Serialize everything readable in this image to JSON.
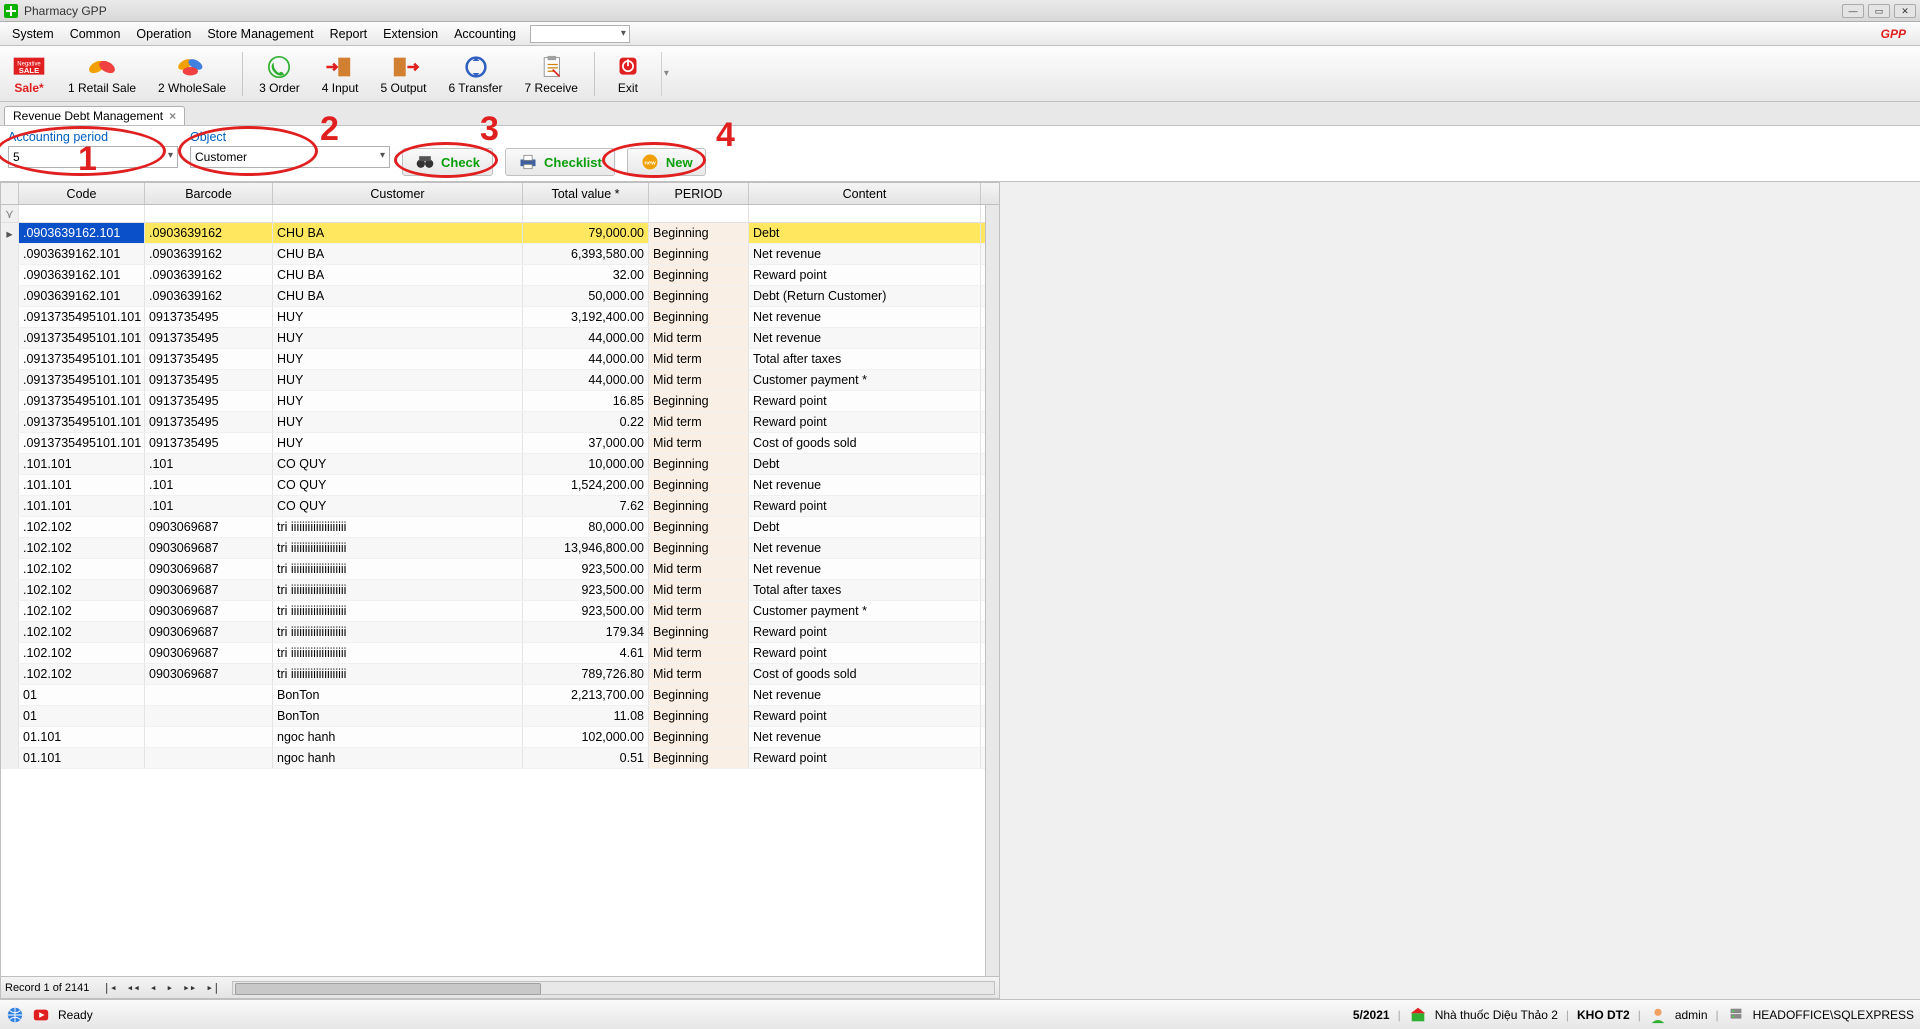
{
  "window": {
    "title": "Pharmacy GPP",
    "gpp": "GPP"
  },
  "menu": [
    "System",
    "Common",
    "Operation",
    "Store Management",
    "Report",
    "Extension",
    "Accounting"
  ],
  "toolbar": {
    "sale": "Sale*",
    "retail": "1 Retail Sale",
    "wholesale": "2 WholeSale",
    "order": "3 Order",
    "input": "4 Input",
    "output": "5 Output",
    "transfer": "6 Transfer",
    "receive": "7 Receive",
    "exit": "Exit"
  },
  "tab": {
    "title": "Revenue Debt Management"
  },
  "filter": {
    "period_label": "Accounting period",
    "period_value": "5",
    "object_label": "Object",
    "object_value": "Customer",
    "check": "Check",
    "checklist": "Checklist",
    "new": "New"
  },
  "annotations": {
    "n1": "1",
    "n2": "2",
    "n3": "3",
    "n4": "4"
  },
  "grid": {
    "record_text": "Record 1 of 2141",
    "headers": {
      "code": "Code",
      "barcode": "Barcode",
      "customer": "Customer",
      "total": "Total value *",
      "period": "PERIOD",
      "content": "Content"
    },
    "rows": [
      {
        "code": ".0903639162.101",
        "barcode": ".0903639162",
        "customer": "CHU BA",
        "total": "79,000.00",
        "period": "Beginning",
        "content": "Debt",
        "sel": true
      },
      {
        "code": ".0903639162.101",
        "barcode": ".0903639162",
        "customer": "CHU BA",
        "total": "6,393,580.00",
        "period": "Beginning",
        "content": "Net revenue"
      },
      {
        "code": ".0903639162.101",
        "barcode": ".0903639162",
        "customer": "CHU BA",
        "total": "32.00",
        "period": "Beginning",
        "content": "Reward point"
      },
      {
        "code": ".0903639162.101",
        "barcode": ".0903639162",
        "customer": "CHU BA",
        "total": "50,000.00",
        "period": "Beginning",
        "content": "Debt (Return Customer)"
      },
      {
        "code": ".0913735495101.101",
        "barcode": "0913735495",
        "customer": "HUY",
        "total": "3,192,400.00",
        "period": "Beginning",
        "content": "Net revenue"
      },
      {
        "code": ".0913735495101.101",
        "barcode": "0913735495",
        "customer": "HUY",
        "total": "44,000.00",
        "period": "Mid term",
        "content": "Net revenue"
      },
      {
        "code": ".0913735495101.101",
        "barcode": "0913735495",
        "customer": "HUY",
        "total": "44,000.00",
        "period": "Mid term",
        "content": "Total after taxes"
      },
      {
        "code": ".0913735495101.101",
        "barcode": "0913735495",
        "customer": "HUY",
        "total": "44,000.00",
        "period": "Mid term",
        "content": "Customer payment *"
      },
      {
        "code": ".0913735495101.101",
        "barcode": "0913735495",
        "customer": "HUY",
        "total": "16.85",
        "period": "Beginning",
        "content": "Reward point"
      },
      {
        "code": ".0913735495101.101",
        "barcode": "0913735495",
        "customer": "HUY",
        "total": "0.22",
        "period": "Mid term",
        "content": "Reward point"
      },
      {
        "code": ".0913735495101.101",
        "barcode": "0913735495",
        "customer": "HUY",
        "total": "37,000.00",
        "period": "Mid term",
        "content": "Cost of goods sold"
      },
      {
        "code": ".101.101",
        "barcode": ".101",
        "customer": "CO QUY",
        "total": "10,000.00",
        "period": "Beginning",
        "content": "Debt"
      },
      {
        "code": ".101.101",
        "barcode": ".101",
        "customer": "CO QUY",
        "total": "1,524,200.00",
        "period": "Beginning",
        "content": "Net revenue"
      },
      {
        "code": ".101.101",
        "barcode": ".101",
        "customer": "CO QUY",
        "total": "7.62",
        "period": "Beginning",
        "content": "Reward point"
      },
      {
        "code": ".102.102",
        "barcode": "0903069687",
        "customer": "tri iiiiiiiiiiiiiiiiiiii",
        "total": "80,000.00",
        "period": "Beginning",
        "content": "Debt"
      },
      {
        "code": ".102.102",
        "barcode": "0903069687",
        "customer": "tri iiiiiiiiiiiiiiiiiiii",
        "total": "13,946,800.00",
        "period": "Beginning",
        "content": "Net revenue"
      },
      {
        "code": ".102.102",
        "barcode": "0903069687",
        "customer": "tri iiiiiiiiiiiiiiiiiiii",
        "total": "923,500.00",
        "period": "Mid term",
        "content": "Net revenue"
      },
      {
        "code": ".102.102",
        "barcode": "0903069687",
        "customer": "tri iiiiiiiiiiiiiiiiiiii",
        "total": "923,500.00",
        "period": "Mid term",
        "content": "Total after taxes"
      },
      {
        "code": ".102.102",
        "barcode": "0903069687",
        "customer": "tri iiiiiiiiiiiiiiiiiiii",
        "total": "923,500.00",
        "period": "Mid term",
        "content": "Customer payment *"
      },
      {
        "code": ".102.102",
        "barcode": "0903069687",
        "customer": "tri iiiiiiiiiiiiiiiiiiii",
        "total": "179.34",
        "period": "Beginning",
        "content": "Reward point"
      },
      {
        "code": ".102.102",
        "barcode": "0903069687",
        "customer": "tri iiiiiiiiiiiiiiiiiiii",
        "total": "4.61",
        "period": "Mid term",
        "content": "Reward point"
      },
      {
        "code": ".102.102",
        "barcode": "0903069687",
        "customer": "tri iiiiiiiiiiiiiiiiiiii",
        "total": "789,726.80",
        "period": "Mid term",
        "content": "Cost of goods sold"
      },
      {
        "code": "01",
        "barcode": "",
        "customer": "BonTon",
        "total": "2,213,700.00",
        "period": "Beginning",
        "content": "Net revenue"
      },
      {
        "code": "01",
        "barcode": "",
        "customer": "BonTon",
        "total": "11.08",
        "period": "Beginning",
        "content": "Reward point"
      },
      {
        "code": "01.101",
        "barcode": "",
        "customer": "ngoc hanh",
        "total": "102,000.00",
        "period": "Beginning",
        "content": "Net revenue"
      },
      {
        "code": "01.101",
        "barcode": "",
        "customer": "ngoc hanh",
        "total": "0.51",
        "period": "Beginning",
        "content": "Reward point"
      }
    ]
  },
  "status": {
    "ready": "Ready",
    "period": "5/2021",
    "store": "Nhà thuốc Diệu Thảo 2",
    "warehouse": "KHO DT2",
    "user": "admin",
    "server": "HEADOFFICE\\SQLEXPRESS"
  }
}
